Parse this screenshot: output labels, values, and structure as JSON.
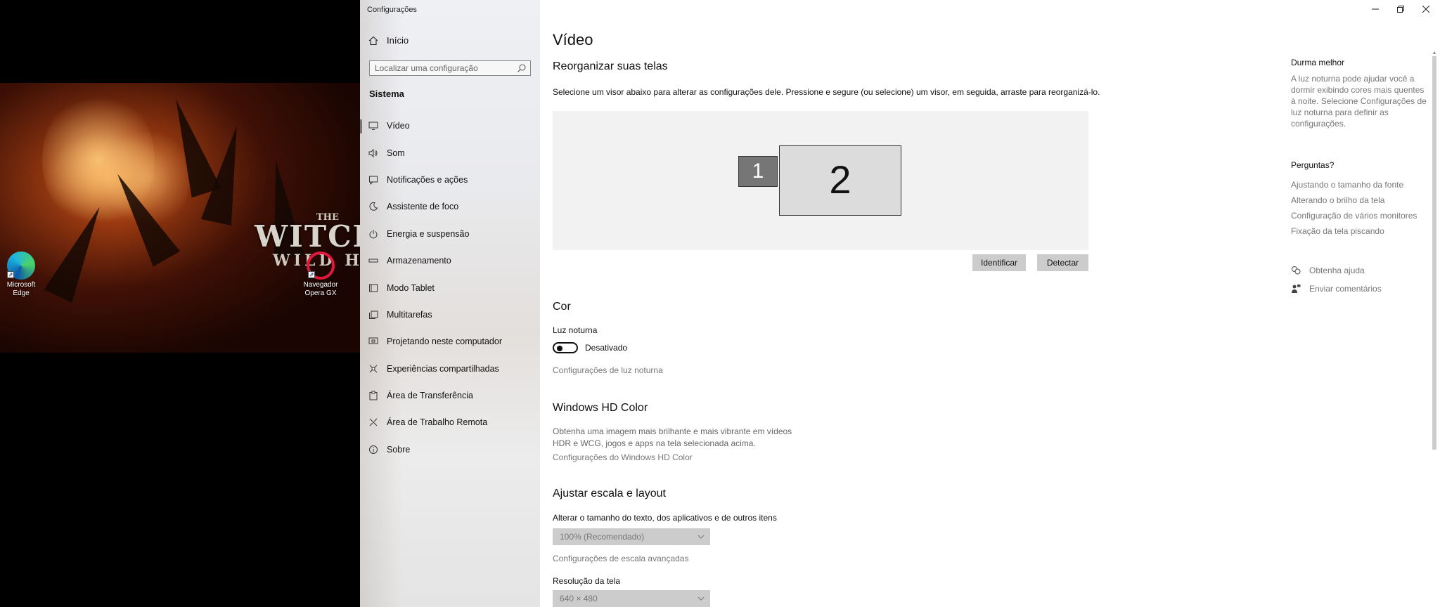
{
  "desktop": {
    "icons": [
      {
        "label_line1": "Microsoft",
        "label_line2": "Edge"
      },
      {
        "label_line1": "Navegador",
        "label_line2": "Opera GX"
      }
    ],
    "wallpaper": {
      "title": "WITCH",
      "subtitle": "WILD HU",
      "the": "THE"
    }
  },
  "window": {
    "title": "Configurações"
  },
  "nav": {
    "home_label": "Início",
    "search_placeholder": "Localizar uma configuração",
    "section_title": "Sistema",
    "items": [
      {
        "label": "Vídeo",
        "icon": "monitor-icon"
      },
      {
        "label": "Som",
        "icon": "speaker-icon"
      },
      {
        "label": "Notificações e ações",
        "icon": "notification-icon"
      },
      {
        "label": "Assistente de foco",
        "icon": "moon-icon"
      },
      {
        "label": "Energia e suspensão",
        "icon": "power-icon"
      },
      {
        "label": "Armazenamento",
        "icon": "storage-icon"
      },
      {
        "label": "Modo Tablet",
        "icon": "tablet-icon"
      },
      {
        "label": "Multitarefas",
        "icon": "multitask-icon"
      },
      {
        "label": "Projetando neste computador",
        "icon": "projector-icon"
      },
      {
        "label": "Experiências compartilhadas",
        "icon": "share-icon"
      },
      {
        "label": "Área de Transferência",
        "icon": "clipboard-icon"
      },
      {
        "label": "Área de Trabalho Remota",
        "icon": "remote-icon"
      },
      {
        "label": "Sobre",
        "icon": "info-icon"
      }
    ]
  },
  "main": {
    "title": "Vídeo",
    "arrange": {
      "heading": "Reorganizar suas telas",
      "description": "Selecione um visor abaixo para alterar as configurações dele. Pressione e segure (ou selecione) um visor, em seguida, arraste para reorganizá-lo.",
      "monitor1": "1",
      "monitor2": "2",
      "identify_label": "Identificar",
      "detect_label": "Detectar"
    },
    "color": {
      "heading": "Cor",
      "night_light_label": "Luz noturna",
      "night_light_state": "Desativado",
      "night_light_link": "Configurações de luz noturna"
    },
    "hdr": {
      "heading": "Windows HD Color",
      "description": "Obtenha uma imagem mais brilhante e mais vibrante em vídeos HDR e WCG, jogos e apps na tela selecionada acima.",
      "link": "Configurações do Windows HD Color"
    },
    "scale": {
      "heading": "Ajustar escala e layout",
      "text_size_label": "Alterar o tamanho do texto, dos aplicativos e de outros itens",
      "text_size_value": "100% (Recomendado)",
      "advanced_link": "Configurações de escala avançadas",
      "resolution_label": "Resolução da tela",
      "resolution_value": "640 × 480"
    }
  },
  "help": {
    "sleep_heading": "Durma melhor",
    "sleep_text": "A luz noturna pode ajudar você a dormir exibindo cores mais quentes à noite. Selecione Configurações de luz noturna para definir as configurações.",
    "questions_heading": "Perguntas?",
    "links": [
      "Ajustando o tamanho da fonte",
      "Alterando o brilho da tela",
      "Configuração de vários monitores",
      "Fixação da tela piscando"
    ],
    "get_help": "Obtenha ajuda",
    "feedback": "Enviar comentários"
  }
}
